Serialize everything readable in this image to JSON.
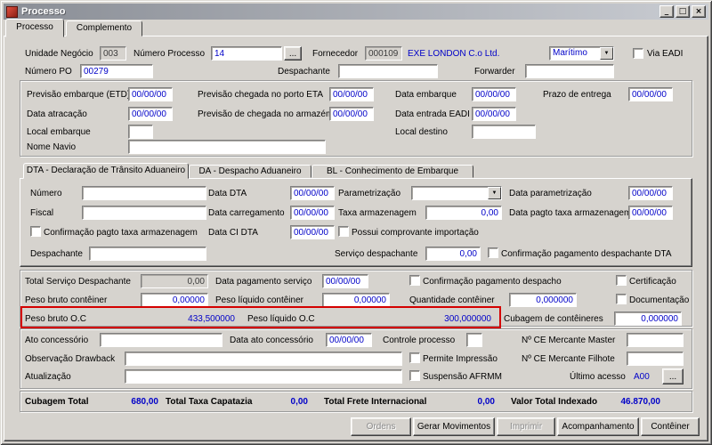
{
  "window": {
    "title": "Processo",
    "minimize": "_",
    "maximize": "□",
    "close": "×"
  },
  "tabs": {
    "processo": "Processo",
    "complemento": "Complemento"
  },
  "icons": {
    "dropdown_arrow": "▼",
    "browse": "..."
  },
  "top": {
    "unidade_negocio": {
      "label": "Unidade Negócio",
      "value": "003"
    },
    "numero_processo": {
      "label": "Número Processo",
      "value": "14"
    },
    "fornecedor": {
      "label": "Fornecedor",
      "code": "000109",
      "name": "EXE LONDON C.o Ltd."
    },
    "modal": {
      "value": "Marítimo"
    },
    "via_eadi": {
      "label": "Via EADI"
    },
    "numero_po": {
      "label": "Número PO",
      "value": "00279"
    },
    "despachante": {
      "label": "Despachante",
      "value": ""
    },
    "forwarder": {
      "label": "Forwarder",
      "value": ""
    }
  },
  "datas": {
    "previsao_embarque_etd": {
      "label": "Previsão embarque (ETD)",
      "value": "00/00/00"
    },
    "previsao_chegada_porto_eta": {
      "label": "Previsão chegada no porto ETA",
      "value": "00/00/00"
    },
    "data_embarque": {
      "label": "Data embarque",
      "value": "00/00/00"
    },
    "prazo_de_entrega": {
      "label": "Prazo de entrega",
      "value": "00/00/00"
    },
    "data_atracacao": {
      "label": "Data atracação",
      "value": "00/00/00"
    },
    "previsao_chegada_armazem": {
      "label": "Previsão de chegada no armazém",
      "value": "00/00/00"
    },
    "data_entrada_eadi": {
      "label": "Data entrada EADI",
      "value": "00/00/00"
    },
    "local_embarque": {
      "label": "Local embarque",
      "value": ""
    },
    "local_destino": {
      "label": "Local destino",
      "value": ""
    },
    "nome_navio": {
      "label": "Nome Navio",
      "value": ""
    }
  },
  "inner_tabs": {
    "dta": "DTA - Declaração de Trânsito Aduaneiro",
    "da": "DA - Despacho Aduaneiro",
    "bl": "BL - Conhecimento de Embarque"
  },
  "dta": {
    "numero": {
      "label": "Número",
      "value": ""
    },
    "data_dta": {
      "label": "Data DTA",
      "value": "00/00/00"
    },
    "parametrizacao": {
      "label": "Parametrização",
      "value": ""
    },
    "data_parametrizacao": {
      "label": "Data parametrização",
      "value": "00/00/00"
    },
    "fiscal": {
      "label": "Fiscal",
      "value": ""
    },
    "data_carregamento": {
      "label": "Data carregamento",
      "value": "00/00/00"
    },
    "taxa_armazenagem": {
      "label": "Taxa armazenagem",
      "value": "0,00"
    },
    "data_pagto_taxa_armazenagem": {
      "label": "Data pagto taxa armazenagem",
      "value": "00/00/00"
    },
    "confirmacao_pagto_taxa": {
      "label": "Confirmação pagto taxa armazenagem"
    },
    "data_ci_dta": {
      "label": "Data CI DTA",
      "value": "00/00/00"
    },
    "possui_comprovante": {
      "label": "Possui comprovante importação"
    },
    "despachante": {
      "label": "Despachante",
      "value": ""
    },
    "servico_despachante": {
      "label": "Serviço despachante",
      "value": "0,00"
    },
    "confirmacao_pag_despachante_dta": {
      "label": "Confirmação pagamento despachante DTA"
    }
  },
  "pesos": {
    "total_servico_despachante": {
      "label": "Total Serviço Despachante",
      "value": "0,00"
    },
    "data_pagamento_servico": {
      "label": "Data pagamento serviço",
      "value": "00/00/00"
    },
    "confirmacao_pag_despacho": {
      "label": "Confirmação pagamento despacho"
    },
    "certificacao": {
      "label": "Certificação"
    },
    "peso_bruto_conteiner": {
      "label": "Peso bruto contêiner",
      "value": "0,00000"
    },
    "peso_liquido_conteiner": {
      "label": "Peso líquido contêiner",
      "value": "0,00000"
    },
    "quantidade_conteiner": {
      "label": "Quantidade contêiner",
      "value": "0,000000"
    },
    "documentacao": {
      "label": "Documentação"
    },
    "peso_bruto_oc": {
      "label": "Peso bruto O.C",
      "value": "433,500000"
    },
    "peso_liquido_oc": {
      "label": "Peso líquido O.C",
      "value": "300,000000"
    },
    "cubagem_conteineres": {
      "label": "Cubagem de contêineres",
      "value": "0,000000"
    }
  },
  "drawback": {
    "ato_concessorio": {
      "label": "Ato concessório",
      "value": ""
    },
    "data_ato_concessorio": {
      "label": "Data ato concessório",
      "value": "00/00/00"
    },
    "controle_processo": {
      "label": "Controle processo",
      "value": ""
    },
    "ce_mercante_master": {
      "label": "Nº CE Mercante Master",
      "value": ""
    },
    "observacao_drawback": {
      "label": "Observação Drawback",
      "value": ""
    },
    "permite_impressao": {
      "label": "Permite Impressão"
    },
    "ce_mercante_filhote": {
      "label": "Nº CE Mercante Filhote",
      "value": ""
    },
    "atualizacao": {
      "label": "Atualização",
      "value": ""
    },
    "suspensao_afrmm": {
      "label": "Suspensão AFRMM"
    },
    "ultimo_acesso": {
      "label": "Último acesso",
      "value": "A00"
    }
  },
  "totais": {
    "cubagem_total": {
      "label": "Cubagem Total",
      "value": "680,00"
    },
    "total_taxa_capatazia": {
      "label": "Total Taxa Capatazia",
      "value": "0,00"
    },
    "total_frete_internacional": {
      "label": "Total Frete Internacional",
      "value": "0,00"
    },
    "valor_total_indexado": {
      "label": "Valor Total Indexado",
      "value": "46.870,00"
    }
  },
  "footer_buttons": {
    "ordens": "Ordens",
    "gerar_movimentos": "Gerar Movimentos",
    "imprimir": "Imprimir",
    "acompanhamento": "Acompanhamento",
    "conteiner": "Contêiner"
  },
  "colors": {
    "value_blue": "#0000c8",
    "highlight_red": "#d40000",
    "window_bg": "#d6d3ce"
  }
}
